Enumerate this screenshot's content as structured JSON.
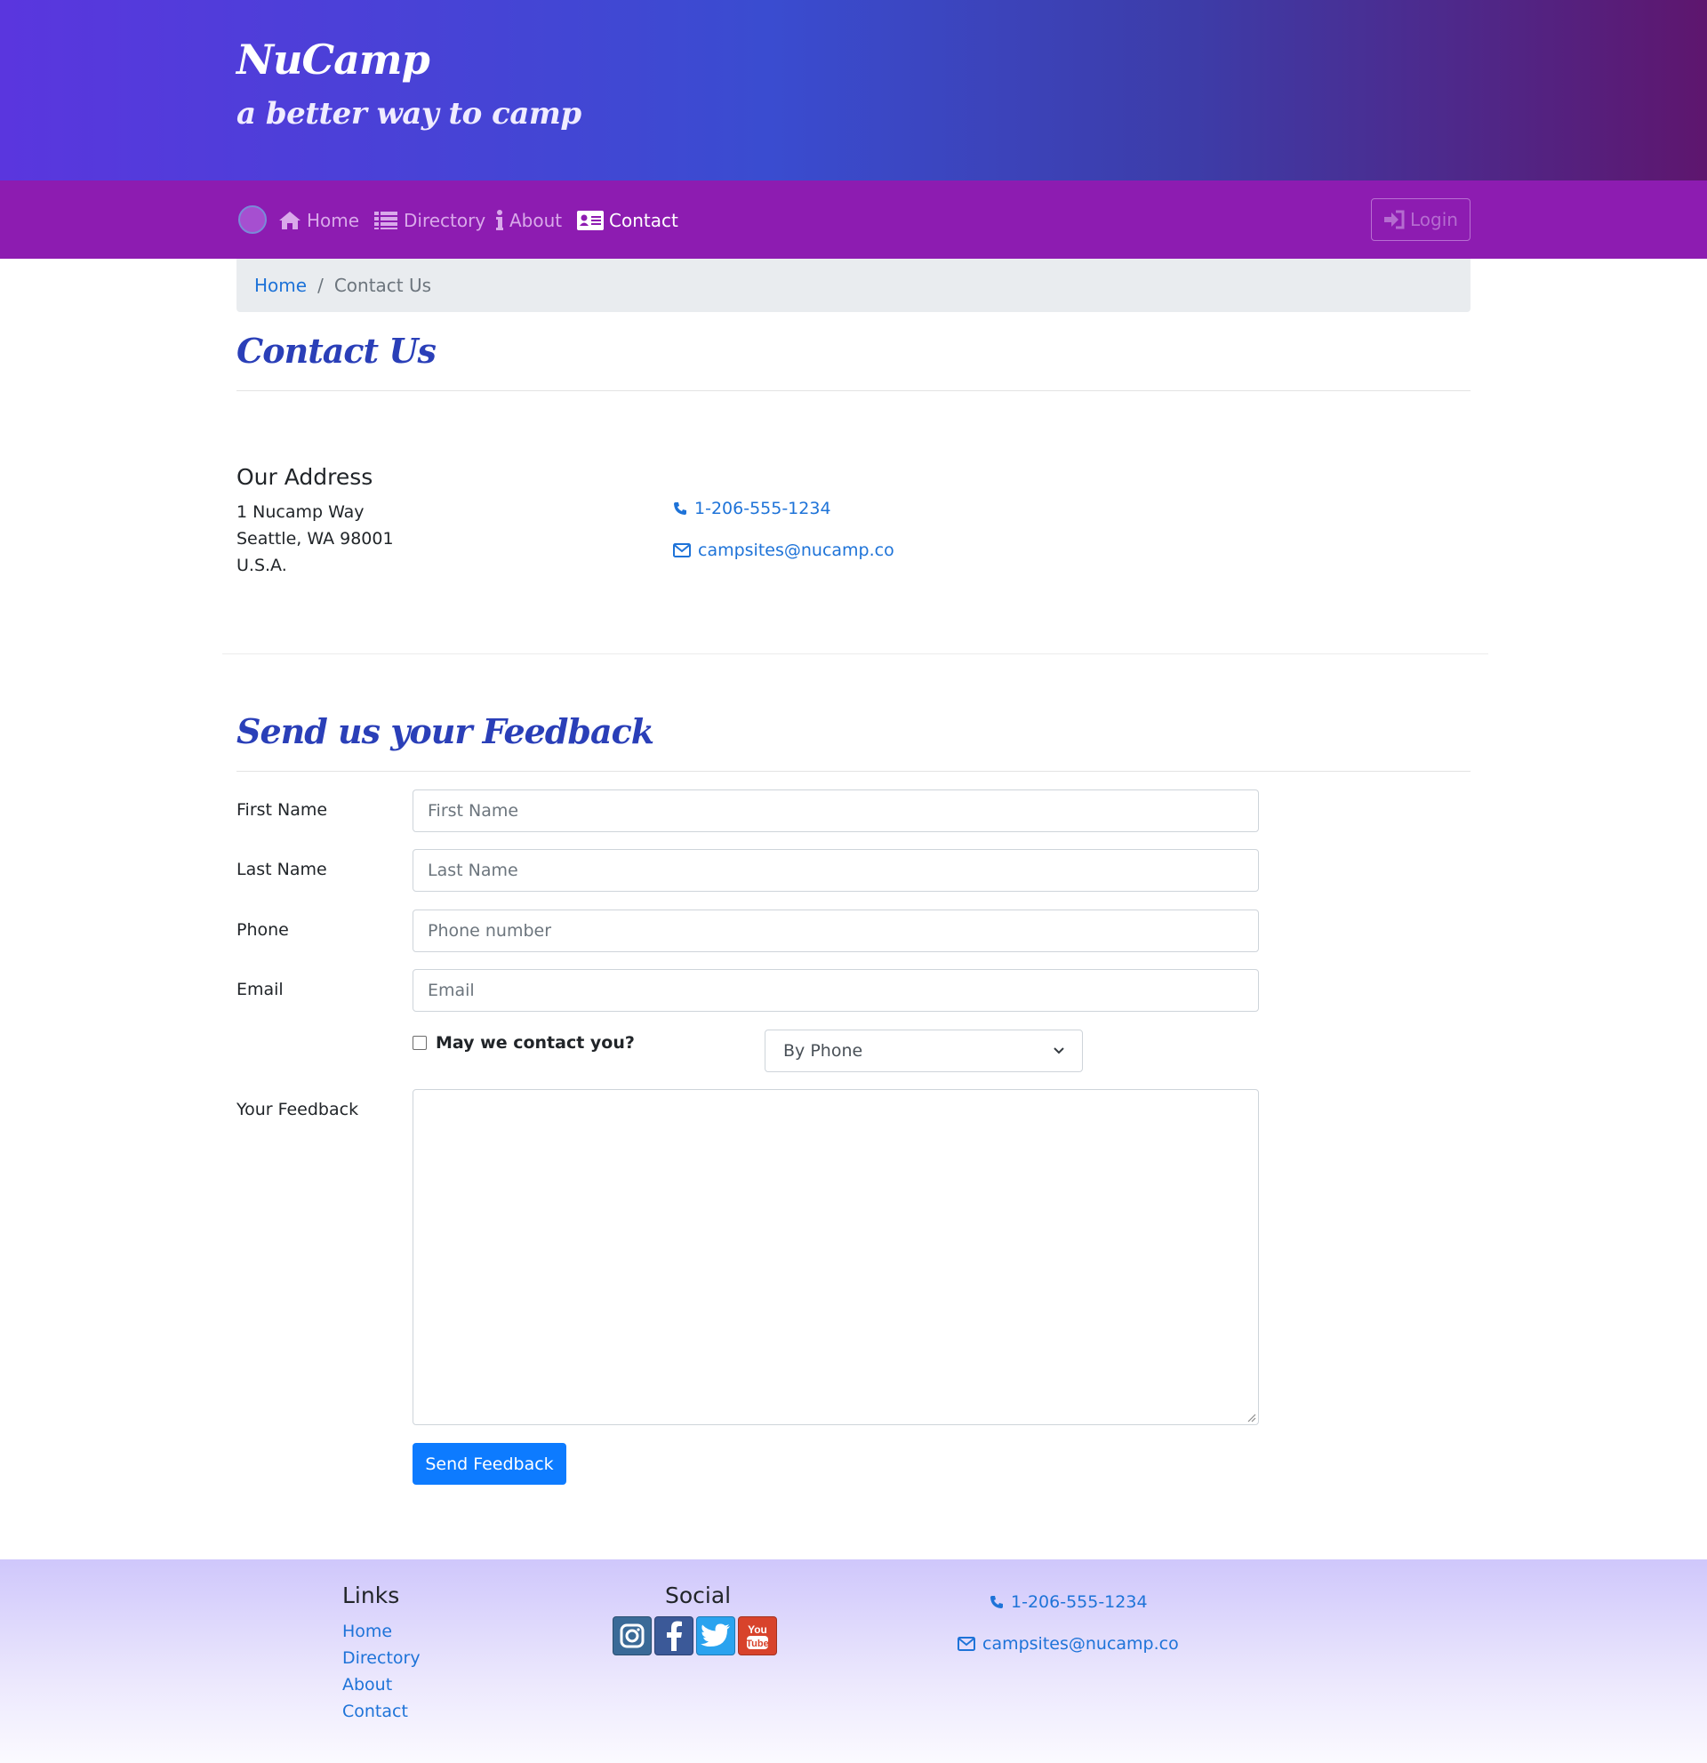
{
  "header": {
    "brand": "NuCamp",
    "tagline": "a better way to camp"
  },
  "nav": {
    "items": [
      {
        "label": "Home",
        "icon": "home-icon"
      },
      {
        "label": "Directory",
        "icon": "list-icon"
      },
      {
        "label": "About",
        "icon": "info-icon"
      },
      {
        "label": "Contact",
        "icon": "address-card-icon",
        "active": true
      }
    ],
    "login_label": "Login"
  },
  "breadcrumb": {
    "home": "Home",
    "separator": "/",
    "current": "Contact Us"
  },
  "page": {
    "title": "Contact Us"
  },
  "address": {
    "heading": "Our Address",
    "line1": "1 Nucamp Way",
    "line2": "Seattle, WA 98001",
    "line3": "U.S.A.",
    "phone": "1-206-555-1234",
    "email": "campsites@nucamp.co"
  },
  "feedback": {
    "title": "Send us your Feedback",
    "first_name_label": "First Name",
    "first_name_placeholder": "First Name",
    "last_name_label": "Last Name",
    "last_name_placeholder": "Last Name",
    "phone_label": "Phone",
    "phone_placeholder": "Phone number",
    "email_label": "Email",
    "email_placeholder": "Email",
    "contact_checkbox_label": "May we contact you?",
    "contact_method_selected": "By Phone",
    "feedback_label": "Your Feedback",
    "submit_label": "Send Feedback"
  },
  "footer": {
    "links_heading": "Links",
    "links": [
      "Home",
      "Directory",
      "About",
      "Contact"
    ],
    "social_heading": "Social",
    "social_icons": [
      "instagram-icon",
      "facebook-icon",
      "twitter-icon",
      "youtube-icon"
    ],
    "phone": "1-206-555-1234",
    "email": "campsites@nucamp.co"
  },
  "colors": {
    "nav_bg": "#8d1cb1",
    "title_color": "#2a3fb8",
    "link_color": "#1e73d8",
    "button_primary": "#0d7bff"
  }
}
